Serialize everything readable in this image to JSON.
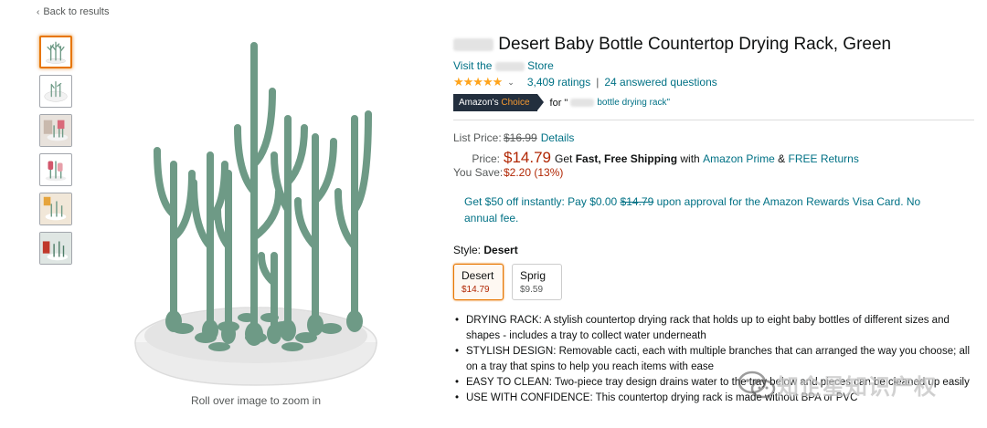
{
  "nav": {
    "back_label": "Back to results"
  },
  "gallery": {
    "zoom_hint": "Roll over image to zoom in",
    "thumbnails": [
      "rack-front",
      "rack-top",
      "rack-in-use",
      "rack-with-bottles",
      "rack-lifestyle",
      "rack-kitchen"
    ]
  },
  "product": {
    "title": "Desert Baby Bottle Countertop Drying Rack, Green",
    "store_prefix": "Visit the",
    "store_suffix": "Store",
    "rating_stars": "★★★★★",
    "ratings_count": "3,409 ratings",
    "answered_questions": "24 answered questions",
    "choice_badge_1": "Amazon's",
    "choice_badge_2": "Choice",
    "choice_for": "for \"",
    "choice_keyword": "bottle drying rack\""
  },
  "pricing": {
    "list_price_label": "List Price:",
    "list_price": "$16.99",
    "details_label": "Details",
    "price_label": "Price:",
    "price": "$14.79",
    "get_label": "Get",
    "fast_shipping": "Fast, Free Shipping",
    "with_label": "with",
    "prime_label": "Amazon Prime",
    "amp": "&",
    "free_returns": "FREE Returns",
    "save_label": "You Save:",
    "save_value": "$2.20 (13%)"
  },
  "promo": {
    "text_1": "Get $50 off instantly: Pay $0.00",
    "strike_price": "$14.79",
    "text_2": "upon approval for the Amazon Rewards Visa Card. No annual fee."
  },
  "style": {
    "label": "Style:",
    "selected": "Desert",
    "options": [
      {
        "name": "Desert",
        "price": "$14.79"
      },
      {
        "name": "Sprig",
        "price": "$9.59"
      }
    ]
  },
  "bullets": [
    "DRYING RACK: A stylish countertop drying rack that holds up to eight baby bottles of different sizes and shapes - includes a tray to collect water underneath",
    "STYLISH DESIGN: Removable cacti, each with multiple branches that can arranged the way you choose; all on a tray that spins to help you reach items with ease",
    "EASY TO CLEAN: Two-piece tray design drains water to the tray below and pieces can be cleaned up easily",
    "USE WITH CONFIDENCE: This countertop drying rack is made without BPA or PVC"
  ],
  "watermark": {
    "text": "知企星知识产权"
  },
  "colors": {
    "accent": "#e77600",
    "link": "#007185",
    "price": "#b12704",
    "rack_green": "#6e9a86",
    "star": "#ffa41c"
  }
}
